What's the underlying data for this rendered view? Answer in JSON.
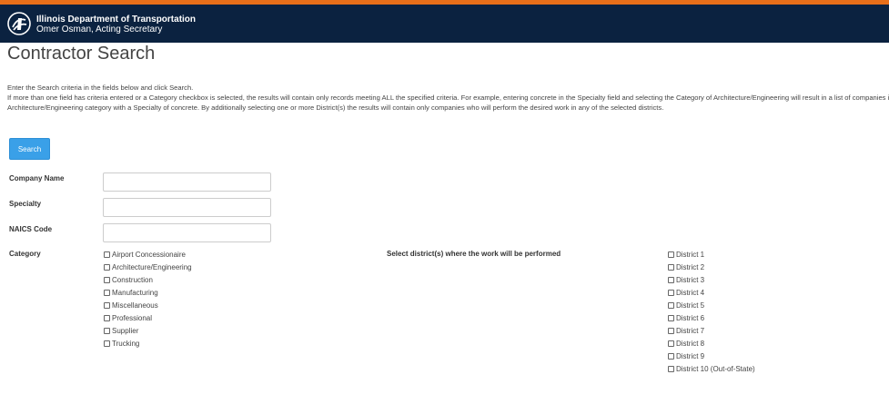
{
  "header": {
    "agency_name": "Illinois Department of Transportation",
    "secretary": "Omer Osman, Acting Secretary"
  },
  "page": {
    "title": "Contractor Search"
  },
  "instructions": {
    "line1": "Enter the Search criteria in the fields below and click Search.",
    "line2": "If more than one field has criteria entered or a Category checkbox is selected, the results will contain only records meeting ALL the specified criteria. For example, entering concrete in the Specialty field and selecting the Category of Architecture/Engineering will result in a list of companies in the",
    "line3": "Architecture/Engineering category with a Specialty of concrete. By additionally selecting one or more District(s) the results will contain only companies who will perform the desired work in any of the selected districts."
  },
  "search": {
    "button_label": "Search"
  },
  "fields": {
    "company_name": {
      "label": "Company Name",
      "value": "",
      "placeholder": ""
    },
    "specialty": {
      "label": "Specialty",
      "value": "",
      "placeholder": ""
    },
    "naics_code": {
      "label": "NAICS Code",
      "value": "",
      "placeholder": ""
    }
  },
  "category": {
    "label": "Category",
    "options": [
      {
        "label": "Airport Concessionaire",
        "checked": false
      },
      {
        "label": "Architecture/Engineering",
        "checked": false
      },
      {
        "label": "Construction",
        "checked": false
      },
      {
        "label": "Manufacturing",
        "checked": false
      },
      {
        "label": "Miscellaneous",
        "checked": false
      },
      {
        "label": "Professional",
        "checked": false
      },
      {
        "label": "Supplier",
        "checked": false
      },
      {
        "label": "Trucking",
        "checked": false
      }
    ]
  },
  "districts": {
    "label": "Select district(s) where the work will be performed",
    "options": [
      {
        "label": "District 1",
        "checked": false
      },
      {
        "label": "District 2",
        "checked": false
      },
      {
        "label": "District 3",
        "checked": false
      },
      {
        "label": "District 4",
        "checked": false
      },
      {
        "label": "District 5",
        "checked": false
      },
      {
        "label": "District 6",
        "checked": false
      },
      {
        "label": "District 7",
        "checked": false
      },
      {
        "label": "District 8",
        "checked": false
      },
      {
        "label": "District 9",
        "checked": false
      },
      {
        "label": "District 10 (Out-of-State)",
        "checked": false
      }
    ]
  },
  "colors": {
    "header_background": "#0b2240",
    "accent_bar": "#e86f1a",
    "button_blue": "#3aa0e8"
  }
}
